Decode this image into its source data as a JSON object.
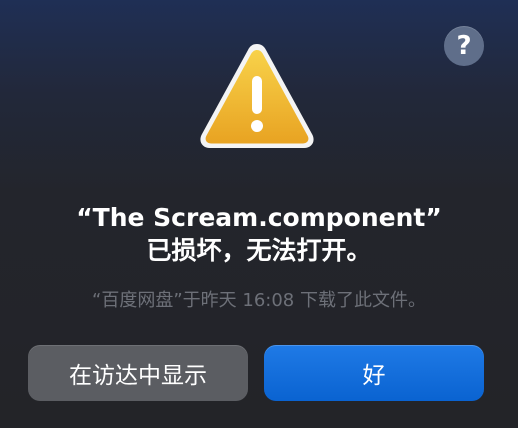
{
  "dialog": {
    "help_label": "?",
    "title_line1": "“The Scream.component”",
    "title_line2": "已损坏，无法打开。",
    "subtitle": "“百度网盘”于昨天 16:08 下载了此文件。",
    "secondary_button": "在访达中显示",
    "primary_button": "好",
    "primary_color": "#0a63d1",
    "warning_color": "#f2b62b"
  },
  "icons": {
    "help": "question-mark-circle-icon",
    "warning": "warning-triangle-icon"
  }
}
